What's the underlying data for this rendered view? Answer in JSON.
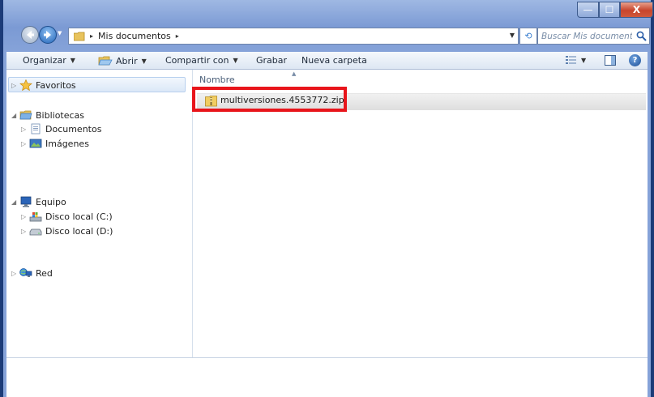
{
  "window": {
    "close_glyph": "X",
    "minimize_glyph": "—",
    "maximize_glyph": "☐"
  },
  "address": {
    "path_text": "Mis documentos",
    "separator": "▸"
  },
  "search": {
    "placeholder": "Buscar Mis documentos",
    "icon": "search-icon"
  },
  "toolbar": {
    "organize_label": "Organizar",
    "open_label": "Abrir",
    "share_label": "Compartir con",
    "burn_label": "Grabar",
    "new_folder_label": "Nueva carpeta",
    "dropdown_glyph": "▼",
    "help_glyph": "?"
  },
  "nav": {
    "favorites": "Favoritos",
    "libraries": "Bibliotecas",
    "documents": "Documentos",
    "images": "Imágenes",
    "computer": "Equipo",
    "disk_c": "Disco local (C:)",
    "disk_d": "Disco local (D:)",
    "network": "Red"
  },
  "content": {
    "column_name": "Nombre",
    "files": [
      {
        "name": "multiversiones.4553772.zip",
        "icon": "zip-folder-icon"
      }
    ]
  },
  "colors": {
    "highlight": "#e8151b",
    "frame": "#7b9ad4",
    "selection": "#dbe8f7"
  }
}
